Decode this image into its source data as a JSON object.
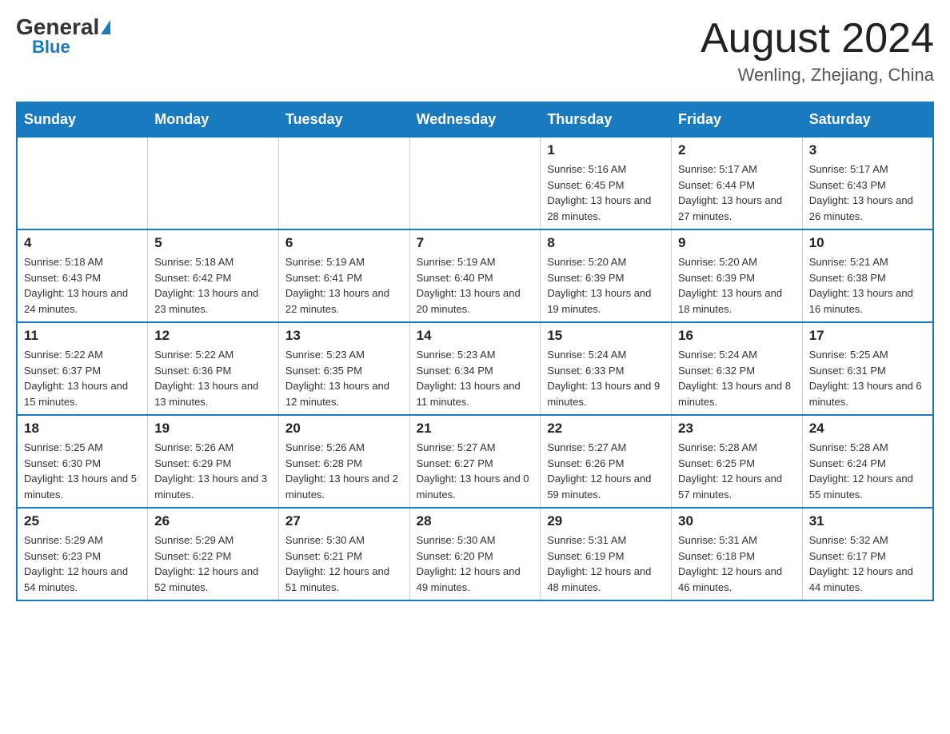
{
  "logo": {
    "general": "General",
    "blue": "Blue",
    "triangle": "▲"
  },
  "title": "August 2024",
  "location": "Wenling, Zhejiang, China",
  "days_of_week": [
    "Sunday",
    "Monday",
    "Tuesday",
    "Wednesday",
    "Thursday",
    "Friday",
    "Saturday"
  ],
  "weeks": [
    [
      {
        "day": "",
        "info": ""
      },
      {
        "day": "",
        "info": ""
      },
      {
        "day": "",
        "info": ""
      },
      {
        "day": "",
        "info": ""
      },
      {
        "day": "1",
        "info": "Sunrise: 5:16 AM\nSunset: 6:45 PM\nDaylight: 13 hours and 28 minutes."
      },
      {
        "day": "2",
        "info": "Sunrise: 5:17 AM\nSunset: 6:44 PM\nDaylight: 13 hours and 27 minutes."
      },
      {
        "day": "3",
        "info": "Sunrise: 5:17 AM\nSunset: 6:43 PM\nDaylight: 13 hours and 26 minutes."
      }
    ],
    [
      {
        "day": "4",
        "info": "Sunrise: 5:18 AM\nSunset: 6:43 PM\nDaylight: 13 hours and 24 minutes."
      },
      {
        "day": "5",
        "info": "Sunrise: 5:18 AM\nSunset: 6:42 PM\nDaylight: 13 hours and 23 minutes."
      },
      {
        "day": "6",
        "info": "Sunrise: 5:19 AM\nSunset: 6:41 PM\nDaylight: 13 hours and 22 minutes."
      },
      {
        "day": "7",
        "info": "Sunrise: 5:19 AM\nSunset: 6:40 PM\nDaylight: 13 hours and 20 minutes."
      },
      {
        "day": "8",
        "info": "Sunrise: 5:20 AM\nSunset: 6:39 PM\nDaylight: 13 hours and 19 minutes."
      },
      {
        "day": "9",
        "info": "Sunrise: 5:20 AM\nSunset: 6:39 PM\nDaylight: 13 hours and 18 minutes."
      },
      {
        "day": "10",
        "info": "Sunrise: 5:21 AM\nSunset: 6:38 PM\nDaylight: 13 hours and 16 minutes."
      }
    ],
    [
      {
        "day": "11",
        "info": "Sunrise: 5:22 AM\nSunset: 6:37 PM\nDaylight: 13 hours and 15 minutes."
      },
      {
        "day": "12",
        "info": "Sunrise: 5:22 AM\nSunset: 6:36 PM\nDaylight: 13 hours and 13 minutes."
      },
      {
        "day": "13",
        "info": "Sunrise: 5:23 AM\nSunset: 6:35 PM\nDaylight: 13 hours and 12 minutes."
      },
      {
        "day": "14",
        "info": "Sunrise: 5:23 AM\nSunset: 6:34 PM\nDaylight: 13 hours and 11 minutes."
      },
      {
        "day": "15",
        "info": "Sunrise: 5:24 AM\nSunset: 6:33 PM\nDaylight: 13 hours and 9 minutes."
      },
      {
        "day": "16",
        "info": "Sunrise: 5:24 AM\nSunset: 6:32 PM\nDaylight: 13 hours and 8 minutes."
      },
      {
        "day": "17",
        "info": "Sunrise: 5:25 AM\nSunset: 6:31 PM\nDaylight: 13 hours and 6 minutes."
      }
    ],
    [
      {
        "day": "18",
        "info": "Sunrise: 5:25 AM\nSunset: 6:30 PM\nDaylight: 13 hours and 5 minutes."
      },
      {
        "day": "19",
        "info": "Sunrise: 5:26 AM\nSunset: 6:29 PM\nDaylight: 13 hours and 3 minutes."
      },
      {
        "day": "20",
        "info": "Sunrise: 5:26 AM\nSunset: 6:28 PM\nDaylight: 13 hours and 2 minutes."
      },
      {
        "day": "21",
        "info": "Sunrise: 5:27 AM\nSunset: 6:27 PM\nDaylight: 13 hours and 0 minutes."
      },
      {
        "day": "22",
        "info": "Sunrise: 5:27 AM\nSunset: 6:26 PM\nDaylight: 12 hours and 59 minutes."
      },
      {
        "day": "23",
        "info": "Sunrise: 5:28 AM\nSunset: 6:25 PM\nDaylight: 12 hours and 57 minutes."
      },
      {
        "day": "24",
        "info": "Sunrise: 5:28 AM\nSunset: 6:24 PM\nDaylight: 12 hours and 55 minutes."
      }
    ],
    [
      {
        "day": "25",
        "info": "Sunrise: 5:29 AM\nSunset: 6:23 PM\nDaylight: 12 hours and 54 minutes."
      },
      {
        "day": "26",
        "info": "Sunrise: 5:29 AM\nSunset: 6:22 PM\nDaylight: 12 hours and 52 minutes."
      },
      {
        "day": "27",
        "info": "Sunrise: 5:30 AM\nSunset: 6:21 PM\nDaylight: 12 hours and 51 minutes."
      },
      {
        "day": "28",
        "info": "Sunrise: 5:30 AM\nSunset: 6:20 PM\nDaylight: 12 hours and 49 minutes."
      },
      {
        "day": "29",
        "info": "Sunrise: 5:31 AM\nSunset: 6:19 PM\nDaylight: 12 hours and 48 minutes."
      },
      {
        "day": "30",
        "info": "Sunrise: 5:31 AM\nSunset: 6:18 PM\nDaylight: 12 hours and 46 minutes."
      },
      {
        "day": "31",
        "info": "Sunrise: 5:32 AM\nSunset: 6:17 PM\nDaylight: 12 hours and 44 minutes."
      }
    ]
  ]
}
